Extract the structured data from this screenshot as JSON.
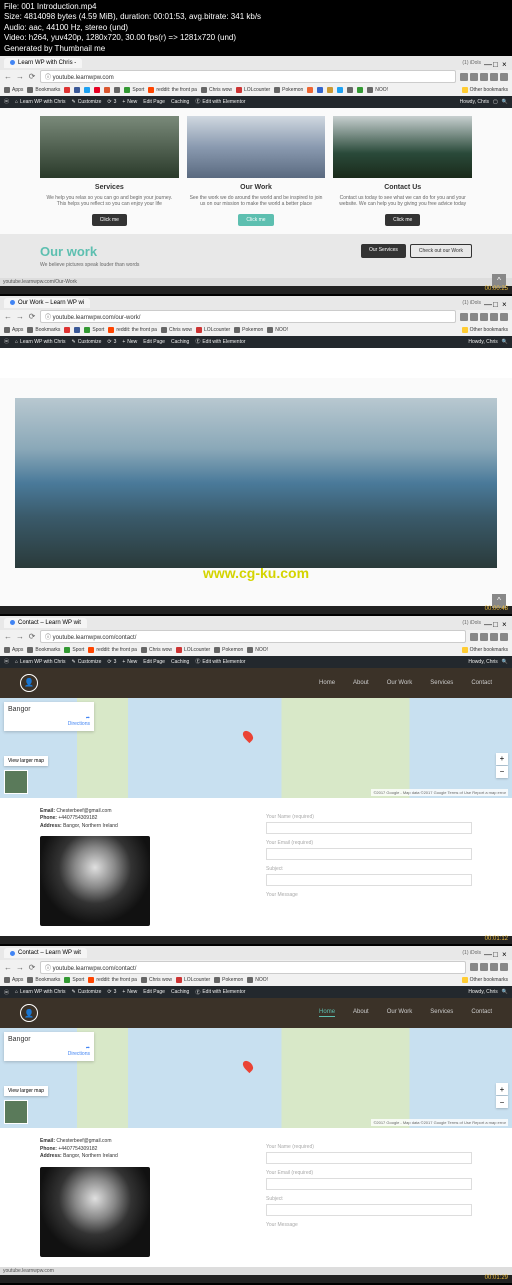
{
  "meta": {
    "file": "File: 001 Introduction.mp4",
    "size": "Size: 4814098 bytes (4.59 MiB), duration: 00:01:53, avg.bitrate: 341 kb/s",
    "audio": "Audio: aac, 44100 Hz, stereo (und)",
    "video": "Video: h264, yuv420p, 1280x720, 30.00 fps(r) => 1281x720 (und)",
    "gen": "Generated by Thumbnail me"
  },
  "chrome": {
    "url1": "youtube.learnwpw.com",
    "url2": "youtube.learnwpw.com/our-work/",
    "url3": "youtube.learnwpw.com/contact/",
    "tab1": "Learn WP with Chris -",
    "tab2": "Our Work – Learn WP wi",
    "tab3": "Contact – Learn WP wit",
    "idols": "(1) iDols",
    "other": "Other bookmarks"
  },
  "bm": {
    "apps": "Apps",
    "bookmarks": "Bookmarks",
    "sport": "Sport",
    "reddit": "reddit: the front pa",
    "chris": "Chris wow",
    "lol": "LOLcounter",
    "pokemon": "Pokemon",
    "noo": "NOO!"
  },
  "wp": {
    "site": "Learn WP with Chris",
    "customize": "Customize",
    "new": "New",
    "editpage": "Edit Page",
    "caching": "Caching",
    "elementor": "Edit with Elementor",
    "howdy": "Howdy, Chris",
    "plus": "+",
    "updates": "3"
  },
  "cards": {
    "services": {
      "title": "Services",
      "desc": "We help you relax so you can go and begin your journey. This helps you reflect so you can enjoy your life",
      "btn": "Click me"
    },
    "work": {
      "title": "Our Work",
      "desc": "See the work we do around the world and be inspired to join us on our mission to make the world a better place",
      "btn": "Click me"
    },
    "contact": {
      "title": "Contact Us",
      "desc": "Contact us today to see what we can do for you and your website. We can help you by giving you free advice today",
      "btn": "Click me"
    }
  },
  "ourwork": {
    "title": "Our work",
    "sub": "We believe pictures speak louder than words",
    "btn1": "Our Services",
    "btn2": "Check out our Work"
  },
  "ts": {
    "p1": "00:00:25",
    "p2": "00:00:48",
    "p3": "00:01:12",
    "p4": "00:01:29"
  },
  "watermark": "www.cg-ku.com",
  "nav": {
    "home": "Home",
    "about": "About",
    "work": "Our Work",
    "services": "Services",
    "contact": "Contact"
  },
  "map": {
    "bangor": "Bangor",
    "directions": "Directions",
    "larger": "View larger map",
    "attr": "©2017 Google - Map data ©2017 Google   Terms of Use   Report a map error"
  },
  "contact": {
    "email_l": "Email:",
    "email_v": "Chesterbeef@gmail.com",
    "phone_l": "Phone:",
    "phone_v": "+4407754309182",
    "addr_l": "Address:",
    "addr_v": "Bangor, Northern Ireland",
    "f_name": "Your Name (required)",
    "f_email": "Your Email (required)",
    "f_subject": "Subject",
    "f_message": "Your Message"
  },
  "status_url": "youtube.learnwpw.com/Our-Work"
}
